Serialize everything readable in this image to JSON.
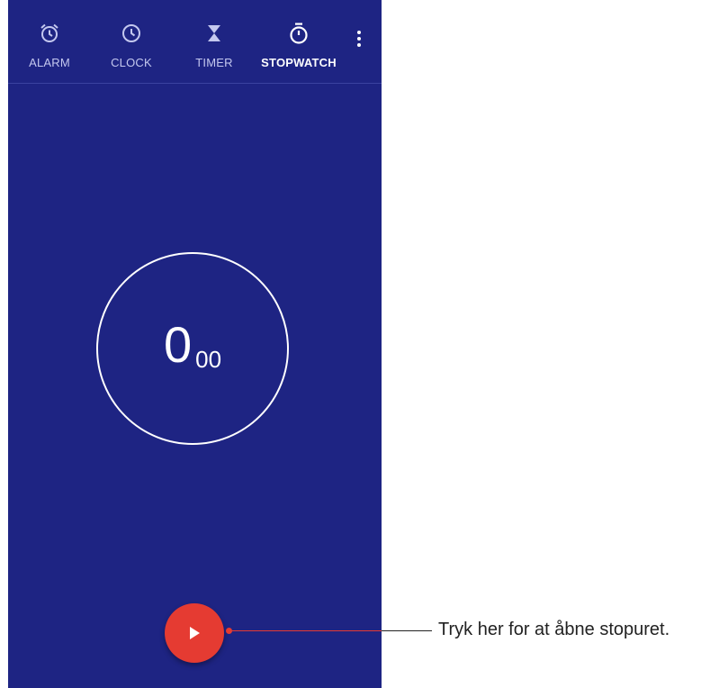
{
  "tabs": [
    {
      "label": "ALARM",
      "icon": "alarm-icon",
      "active": false
    },
    {
      "label": "CLOCK",
      "icon": "clock-icon",
      "active": false
    },
    {
      "label": "TIMER",
      "icon": "hourglass-icon",
      "active": false
    },
    {
      "label": "STOPWATCH",
      "icon": "stopwatch-icon",
      "active": true
    }
  ],
  "stopwatch": {
    "seconds": "0",
    "hundredths": "00"
  },
  "callout": {
    "text": "Tryk her for at åbne stopuret."
  },
  "colors": {
    "background": "#1e2483",
    "accent": "#e53b32",
    "inactive_label": "#c4c8ef"
  }
}
